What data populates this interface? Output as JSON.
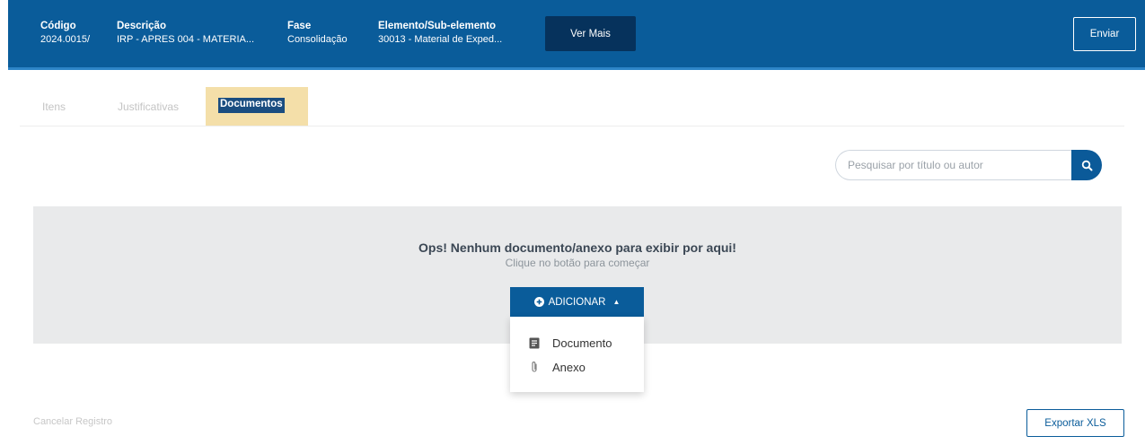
{
  "header": {
    "fields": [
      {
        "label": "Código",
        "value": "2024.0015/"
      },
      {
        "label": "Descrição",
        "value": "IRP - APRES 004 - MATERIA..."
      },
      {
        "label": "Fase",
        "value": "Consolidação"
      },
      {
        "label": "Elemento/Sub-elemento",
        "value": "30013 - Material de Exped..."
      }
    ],
    "ver_mais_label": "Ver Mais",
    "enviar_label": "Enviar"
  },
  "tabs": [
    {
      "label": "Itens",
      "active": false
    },
    {
      "label": "Justificativas",
      "active": false
    },
    {
      "label": "Documentos",
      "active": true
    }
  ],
  "search": {
    "placeholder": "Pesquisar por título ou autor",
    "icon": "search-icon"
  },
  "empty_state": {
    "title": "Ops! Nenhum documento/anexo para exibir por aqui!",
    "subtitle": "Clique no botão para começar"
  },
  "add_button": {
    "label": "ADICIONAR",
    "icon": "plus-circle-icon",
    "caret": "▲"
  },
  "dropdown": {
    "items": [
      {
        "label": "Documento",
        "icon": "document-icon"
      },
      {
        "label": "Anexo",
        "icon": "paperclip-icon"
      }
    ]
  },
  "footer": {
    "cancel_label": "Cancelar Registro",
    "export_label": "Exportar XLS"
  },
  "colors": {
    "header_bg": "#0a5c9a",
    "ver_mais_bg": "#06325c",
    "panel_bg": "#e9eaeb",
    "tab_highlight": "#f4dfa9"
  }
}
